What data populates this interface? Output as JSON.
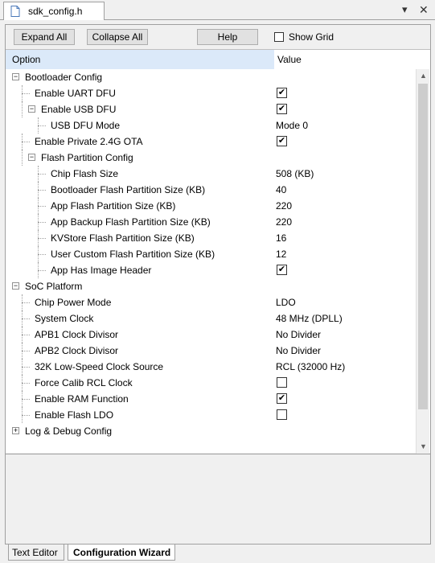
{
  "tab": {
    "title": "sdk_config.h"
  },
  "window_buttons": {
    "dropdown": "▾",
    "close": "✕"
  },
  "toolbar": {
    "expand_all": "Expand All",
    "collapse_all": "Collapse All",
    "help": "Help",
    "show_grid": "Show Grid",
    "show_grid_checked": false
  },
  "columns": {
    "option": "Option",
    "value": "Value"
  },
  "tree": [
    {
      "label": "Bootloader Config",
      "level": 0,
      "expandable": true,
      "expanded": true,
      "value": null,
      "checked": null
    },
    {
      "label": "Enable UART DFU",
      "level": 1,
      "expandable": false,
      "value": null,
      "checked": true
    },
    {
      "label": "Enable USB DFU",
      "level": 1,
      "expandable": true,
      "expanded": true,
      "value": null,
      "checked": true
    },
    {
      "label": "USB DFU Mode",
      "level": 2,
      "expandable": false,
      "value": "Mode 0",
      "checked": null
    },
    {
      "label": "Enable Private 2.4G OTA",
      "level": 1,
      "expandable": false,
      "value": null,
      "checked": true
    },
    {
      "label": "Flash Partition Config",
      "level": 1,
      "expandable": true,
      "expanded": true,
      "value": null,
      "checked": null
    },
    {
      "label": "Chip Flash Size",
      "level": 2,
      "expandable": false,
      "value": "508 (KB)",
      "checked": null
    },
    {
      "label": "Bootloader Flash Partition Size (KB)",
      "level": 2,
      "expandable": false,
      "value": "40",
      "checked": null
    },
    {
      "label": "App Flash Partition Size (KB)",
      "level": 2,
      "expandable": false,
      "value": "220",
      "checked": null
    },
    {
      "label": "App Backup Flash Partition Size (KB)",
      "level": 2,
      "expandable": false,
      "value": "220",
      "checked": null
    },
    {
      "label": "KVStore Flash Partition Size (KB)",
      "level": 2,
      "expandable": false,
      "value": "16",
      "checked": null
    },
    {
      "label": "User Custom Flash Partition Size (KB)",
      "level": 2,
      "expandable": false,
      "value": "12",
      "checked": null
    },
    {
      "label": "App Has Image Header",
      "level": 2,
      "expandable": false,
      "value": null,
      "checked": true
    },
    {
      "label": "SoC Platform",
      "level": 0,
      "expandable": true,
      "expanded": true,
      "value": null,
      "checked": null
    },
    {
      "label": "Chip Power Mode",
      "level": 1,
      "expandable": false,
      "value": "LDO",
      "checked": null
    },
    {
      "label": "System Clock",
      "level": 1,
      "expandable": false,
      "value": "48 MHz (DPLL)",
      "checked": null
    },
    {
      "label": "APB1 Clock Divisor",
      "level": 1,
      "expandable": false,
      "value": "No Divider",
      "checked": null
    },
    {
      "label": "APB2 Clock Divisor",
      "level": 1,
      "expandable": false,
      "value": "No Divider",
      "checked": null
    },
    {
      "label": "32K Low-Speed Clock Source",
      "level": 1,
      "expandable": false,
      "value": "RCL (32000 Hz)",
      "checked": null
    },
    {
      "label": "Force Calib RCL Clock",
      "level": 1,
      "expandable": false,
      "value": null,
      "checked": false
    },
    {
      "label": "Enable RAM Function",
      "level": 1,
      "expandable": false,
      "value": null,
      "checked": true
    },
    {
      "label": "Enable Flash LDO",
      "level": 1,
      "expandable": false,
      "value": null,
      "checked": false
    },
    {
      "label": "Log & Debug Config",
      "level": 0,
      "expandable": true,
      "expanded": false,
      "value": null,
      "checked": null
    }
  ],
  "bottom_tabs": [
    "Text Editor",
    "Configuration Wizard"
  ],
  "colors": {
    "header_highlight": "#dbe9f9",
    "frame_border": "#a0a0a0",
    "background": "#f0f0f0"
  }
}
